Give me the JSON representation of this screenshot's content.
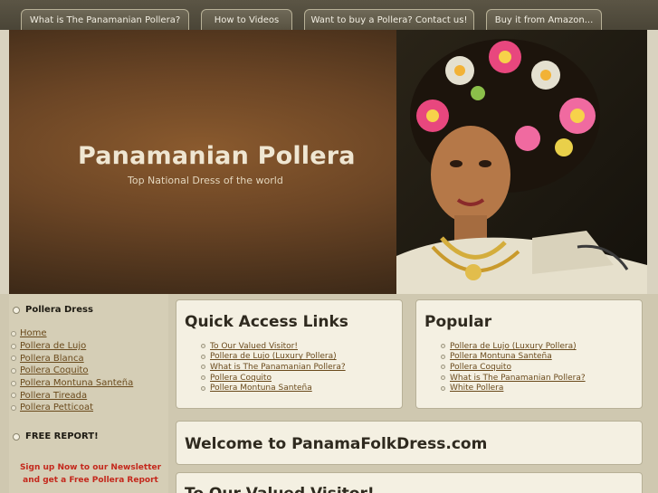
{
  "nav": {
    "tabs": [
      {
        "label": "What is The Panamanian Pollera?"
      },
      {
        "label": "How to Videos"
      },
      {
        "label": "Want to buy a Pollera? Contact us!"
      },
      {
        "label": "Buy it from Amazon..."
      }
    ]
  },
  "header": {
    "title": "Panamanian Pollera",
    "tagline": "Top National Dress of the world"
  },
  "sidebar": {
    "heading": "Pollera Dress",
    "items": [
      {
        "label": "Home"
      },
      {
        "label": "Pollera de Lujo"
      },
      {
        "label": "Pollera Blanca"
      },
      {
        "label": "Pollera Coquito"
      },
      {
        "label": "Pollera Montuna Santeña"
      },
      {
        "label": "Pollera Tireada"
      },
      {
        "label": "Pollera Petticoat"
      }
    ],
    "report_heading": "FREE REPORT!",
    "signup_text": "Sign up Now to our Newsletter and get a Free Pollera Report"
  },
  "quick_access": {
    "title": "Quick Access Links",
    "links": [
      {
        "label": "To Our Valued Visitor!"
      },
      {
        "label": "Pollera de Lujo (Luxury Pollera)"
      },
      {
        "label": "What is The Panamanian Pollera?"
      },
      {
        "label": "Pollera Coquito"
      },
      {
        "label": "Pollera Montuna Santeña"
      }
    ]
  },
  "popular": {
    "title": "Popular",
    "links": [
      {
        "label": "Pollera de Lujo (Luxury Pollera)"
      },
      {
        "label": "Pollera Montuna Santeña"
      },
      {
        "label": "Pollera Coquito"
      },
      {
        "label": "What is The Panamanian Pollera?"
      },
      {
        "label": "White Pollera"
      }
    ]
  },
  "welcome": {
    "title": "Welcome to PanamaFolkDress.com"
  },
  "visitor": {
    "title": "To Our Valued Visitor!"
  },
  "colors": {
    "nav_bg": "#4f4a3c",
    "link": "#6a4a1c",
    "signup_red": "#c4281c",
    "panel_bg": "#f4f0e2"
  }
}
